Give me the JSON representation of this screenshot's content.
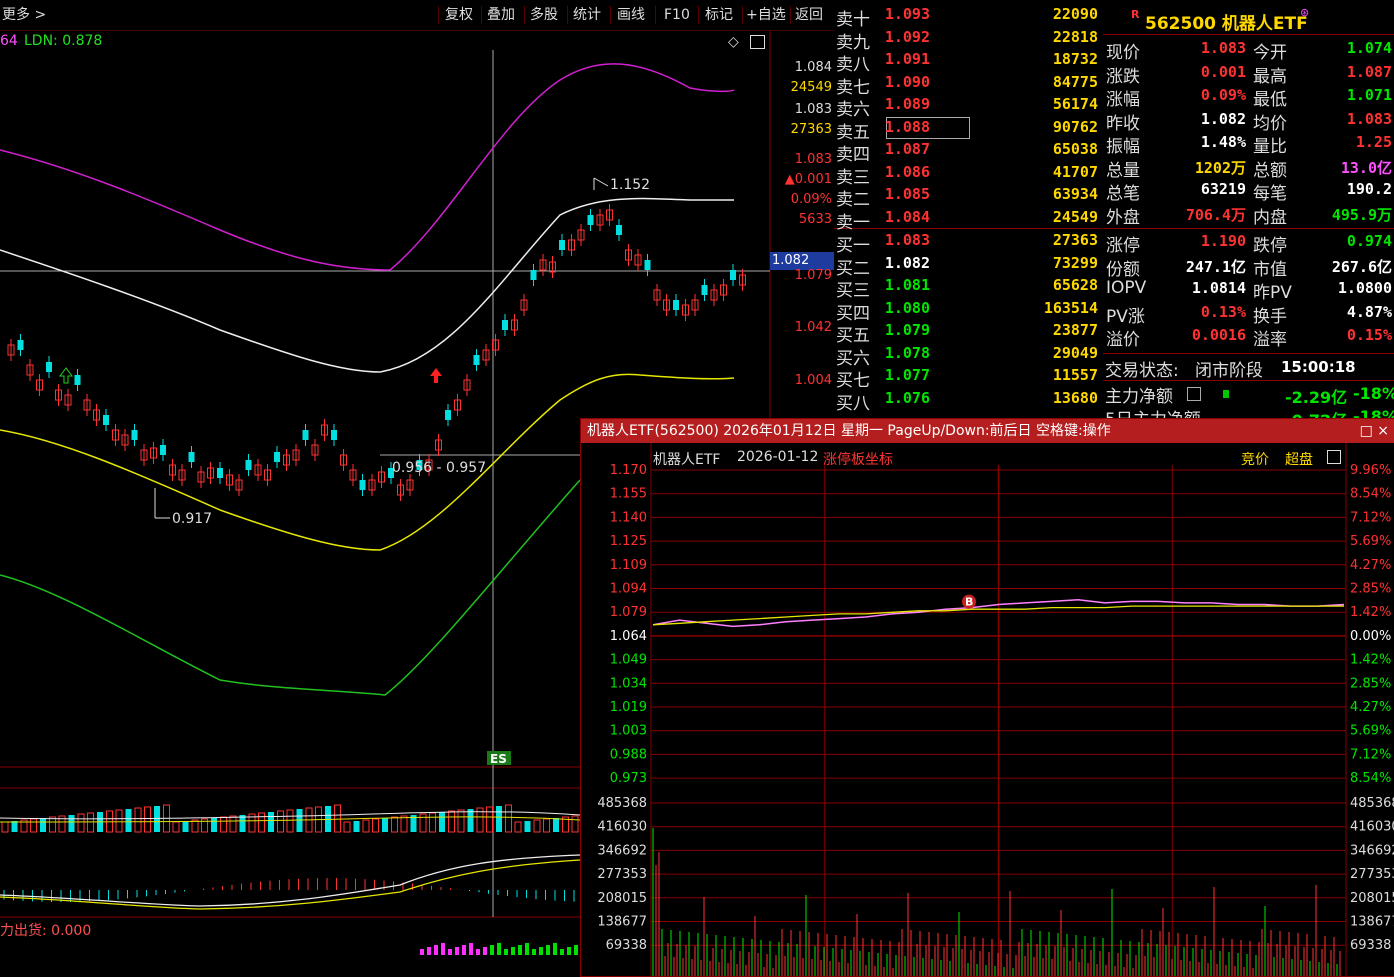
{
  "toolbar": {
    "more": "更多",
    "buttons": [
      "复权",
      "叠加",
      "多股",
      "统计",
      "画线",
      "F10",
      "标记",
      "+自选",
      "返回"
    ]
  },
  "indicator": {
    "prefix": "64",
    "ldn": "LDN: 0.878"
  },
  "kline_annotations": {
    "high": "1.152",
    "low": "0.917",
    "range": "0.956 - 0.957",
    "bottom_label": "力出货: 0.000"
  },
  "right_axis": {
    "labels": [
      "1.084",
      "24549",
      "1.083",
      "27363",
      "1.083",
      "▲0.001",
      "0.09%",
      "5633",
      "1.079",
      "1.042",
      "1.004"
    ],
    "current_price": "1.082"
  },
  "orderbook": {
    "asks": [
      {
        "label": "卖十",
        "price": "1.093",
        "vol": "22090"
      },
      {
        "label": "卖九",
        "price": "1.092",
        "vol": "22818"
      },
      {
        "label": "卖八",
        "price": "1.091",
        "vol": "18732"
      },
      {
        "label": "卖七",
        "price": "1.090",
        "vol": "84775"
      },
      {
        "label": "卖六",
        "price": "1.089",
        "vol": "56174"
      },
      {
        "label": "卖五",
        "price": "1.088",
        "vol": "90762"
      },
      {
        "label": "卖四",
        "price": "1.087",
        "vol": "65038"
      },
      {
        "label": "卖三",
        "price": "1.086",
        "vol": "41707"
      },
      {
        "label": "卖二",
        "price": "1.085",
        "vol": "63934"
      },
      {
        "label": "卖一",
        "price": "1.084",
        "vol": "24549"
      }
    ],
    "bids": [
      {
        "label": "买一",
        "price": "1.083",
        "vol": "27363"
      },
      {
        "label": "买二",
        "price": "1.082",
        "vol": "73299"
      },
      {
        "label": "买三",
        "price": "1.081",
        "vol": "65628"
      },
      {
        "label": "买四",
        "price": "1.080",
        "vol": "163514"
      },
      {
        "label": "买五",
        "price": "1.079",
        "vol": "23877"
      },
      {
        "label": "买六",
        "price": "1.078",
        "vol": "29049"
      },
      {
        "label": "买七",
        "price": "1.077",
        "vol": "11557"
      },
      {
        "label": "买八",
        "price": "1.076",
        "vol": "13680"
      }
    ]
  },
  "quote": {
    "badge": "R",
    "title": "562500 机器人ETF",
    "rows": [
      {
        "l1": "现价",
        "v1": "1.083",
        "c1": "red",
        "l2": "今开",
        "v2": "1.074",
        "c2": "green"
      },
      {
        "l1": "涨跌",
        "v1": "0.001",
        "c1": "red",
        "l2": "最高",
        "v2": "1.087",
        "c2": "red"
      },
      {
        "l1": "涨幅",
        "v1": "0.09%",
        "c1": "red",
        "l2": "最低",
        "v2": "1.071",
        "c2": "green"
      },
      {
        "l1": "昨收",
        "v1": "1.082",
        "c1": "white",
        "l2": "均价",
        "v2": "1.083",
        "c2": "red"
      },
      {
        "l1": "振幅",
        "v1": "1.48%",
        "c1": "white",
        "l2": "量比",
        "v2": "1.25",
        "c2": "red"
      },
      {
        "l1": "总量",
        "v1": "1202万",
        "c1": "yellow",
        "l2": "总额",
        "v2": "13.0亿",
        "c2": "mag"
      },
      {
        "l1": "总笔",
        "v1": "63219",
        "c1": "white",
        "l2": "每笔",
        "v2": "190.2",
        "c2": "white"
      },
      {
        "l1": "外盘",
        "v1": "706.4万",
        "c1": "red",
        "l2": "内盘",
        "v2": "495.9万",
        "c2": "green"
      },
      {
        "l1": "涨停",
        "v1": "1.190",
        "c1": "red",
        "l2": "跌停",
        "v2": "0.974",
        "c2": "green"
      },
      {
        "l1": "份额",
        "v1": "247.1亿",
        "c1": "white",
        "l2": "市值",
        "v2": "267.6亿",
        "c2": "white"
      },
      {
        "l1": "IOPV",
        "v1": "1.0814",
        "c1": "white",
        "l2": "昨PV",
        "v2": "1.0800",
        "c2": "white"
      },
      {
        "l1": "PV涨",
        "v1": "0.13%",
        "c1": "red",
        "l2": "换手",
        "v2": "4.87%",
        "c2": "white"
      },
      {
        "l1": "溢价",
        "v1": "0.0016",
        "c1": "red",
        "l2": "溢率",
        "v2": "0.15%",
        "c2": "red"
      }
    ],
    "status_label": "交易状态:",
    "status_value": "闭市阶段",
    "status_time": "15:00:18",
    "main_flow_label": "主力净额",
    "main_flow_value": "-2.29亿",
    "main_flow_pct": "-18%",
    "flow5_label": "5日主力净额",
    "flow5_value": "-0.72亿",
    "flow5_pct": "-18%"
  },
  "popup": {
    "title": "机器人ETF(562500) 2026年01月12日 星期一 PageUp/Down:前后日 空格键:操作",
    "close": "□ ×",
    "header_name": "机器人ETF",
    "header_date": "2026-01-12",
    "header_mode": "涨停板坐标",
    "btn_auction": "竞价",
    "btn_super": "超盘",
    "price_labels": [
      "1.170",
      "1.155",
      "1.140",
      "1.125",
      "1.109",
      "1.094",
      "1.079",
      "1.064",
      "1.049",
      "1.034",
      "1.019",
      "1.003",
      "0.988",
      "0.973"
    ],
    "pct_labels": [
      "9.96%",
      "8.54%",
      "7.12%",
      "5.69%",
      "4.27%",
      "2.85%",
      "1.42%",
      "0.00%",
      "1.42%",
      "2.85%",
      "4.27%",
      "5.69%",
      "7.12%",
      "8.54%"
    ],
    "vol_labels": [
      "485368",
      "416030",
      "346692",
      "277353",
      "208015",
      "138677",
      "69338"
    ],
    "b_marker": "B",
    "price_line": [
      1.071,
      1.074,
      1.072,
      1.07,
      1.071,
      1.073,
      1.074,
      1.075,
      1.076,
      1.078,
      1.079,
      1.081,
      1.082,
      1.084,
      1.085,
      1.086,
      1.087,
      1.085,
      1.086,
      1.086,
      1.085,
      1.085,
      1.084,
      1.084,
      1.083,
      1.083,
      1.084
    ],
    "avg_line": [
      1.071,
      1.072,
      1.073,
      1.074,
      1.075,
      1.076,
      1.077,
      1.078,
      1.078,
      1.079,
      1.08,
      1.08,
      1.081,
      1.081,
      1.081,
      1.082,
      1.082,
      1.082,
      1.083,
      1.083,
      1.083,
      1.083,
      1.083,
      1.083,
      1.083,
      1.083,
      1.083
    ]
  }
}
